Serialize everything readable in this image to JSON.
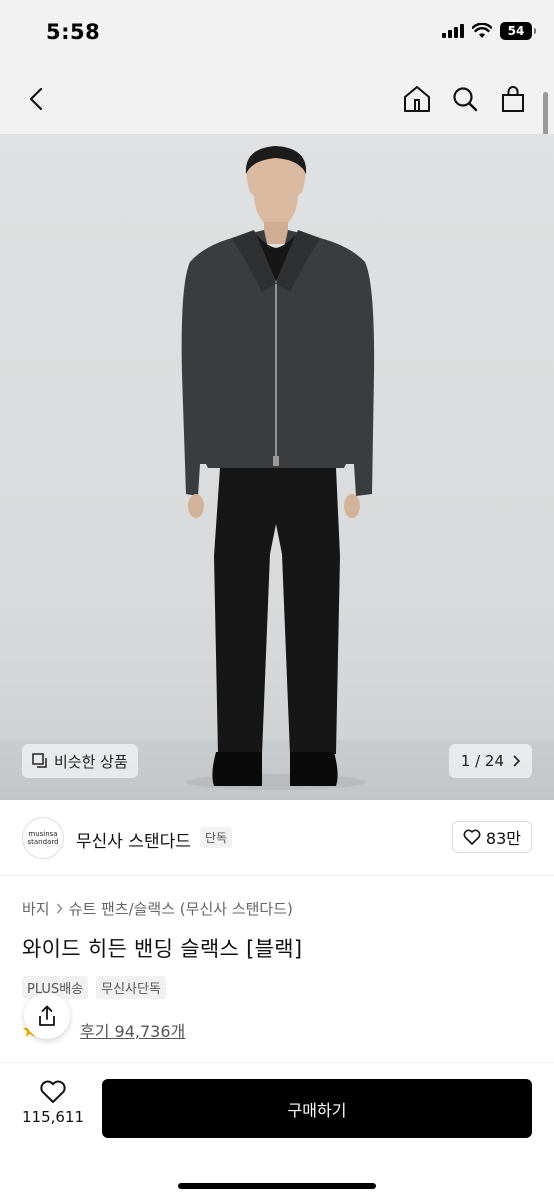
{
  "status_bar": {
    "time": "5:58",
    "battery": "54"
  },
  "nav": {
    "back_icon": "chevron-left-icon",
    "home_icon": "home-icon",
    "search_icon": "search-icon",
    "cart_icon": "shopping-bag-icon"
  },
  "gallery": {
    "similar_label": "비슷한 상품",
    "pager": "1 / 24"
  },
  "brand": {
    "logo_line1": "musinsa",
    "logo_line2": "standard",
    "name": "무신사 스탠다드",
    "exclusive_tag": "단독",
    "likes": "83만"
  },
  "product": {
    "breadcrumb": [
      "바지",
      "슈트 팬츠/슬랙스 (무신사 스탠다드)"
    ],
    "title": "와이드 히든 밴딩 슬랙스 [블랙]",
    "tags": [
      "PLUS배송",
      "무신사단독"
    ],
    "review_label": "후기 94,736개"
  },
  "bottom_bar": {
    "wish_count": "115,611",
    "buy_label": "구매하기"
  },
  "colors": {
    "primary_button": "#000000",
    "image_bg": "#dcdedf"
  }
}
